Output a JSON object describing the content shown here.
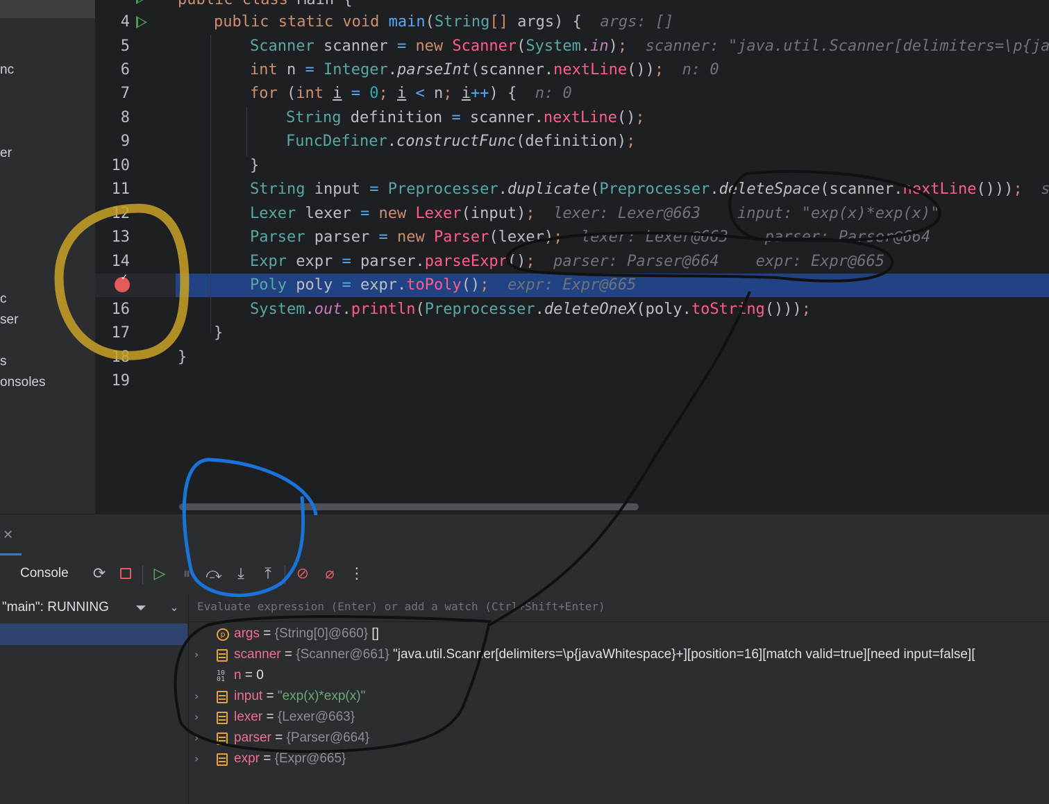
{
  "sidebar": {
    "fragments": [
      "nc",
      "er",
      "c",
      "ser",
      "s",
      "onsoles"
    ]
  },
  "editor": {
    "line_numbers": [
      "4",
      "5",
      "6",
      "7",
      "8",
      "9",
      "10",
      "11",
      "12",
      "13",
      "14",
      "16",
      "17",
      "18",
      "19"
    ],
    "lines": {
      "l3": "public class Main {",
      "l4": "public static void main(String[] args) {",
      "l4_hint": "args: []",
      "l5": "Scanner scanner = new Scanner(System.in);",
      "l5_hint": "scanner: \"java.util.Scanner[delimiters=\\p{jav",
      "l6": "int n = Integer.parseInt(scanner.nextLine());",
      "l6_hint": "n: 0",
      "l7": "for (int i = 0; i < n; i++) {",
      "l7_hint": "n: 0",
      "l8": "String definition = scanner.nextLine();",
      "l9": "FuncDefiner.constructFunc(definition);",
      "l10": "}",
      "l11": "String input = Preprocesser.duplicate(Preprocesser.deleteSpace(scanner.nextLine()));",
      "l11_hint": "sc",
      "l12": "Lexer lexer = new Lexer(input);",
      "l12_hint1": "lexer: Lexer@663",
      "l12_hint2": "input: \"exp(x)*exp(x)\"",
      "l13": "Parser parser = new Parser(lexer);",
      "l13_hint1": "lexer: Lexer@663",
      "l13_hint2": "parser: Parser@664",
      "l14": "Expr expr = parser.parseExpr();",
      "l14_hint1": "parser: Parser@664",
      "l14_hint2": "expr: Expr@665",
      "l15": "Poly poly = expr.toPoly();",
      "l15_hint": "expr: Expr@665",
      "l16": "System.out.println(Preprocesser.deleteOneX(poly.toString()));",
      "l17": "}",
      "l18": "}"
    }
  },
  "debug": {
    "console_tab": "Console",
    "thread": "\"main\": RUNNING",
    "evaluate_placeholder": "Evaluate expression (Enter) or add a watch (Ctrl+Shift+Enter)",
    "variables": [
      {
        "name": "args",
        "eq": " = ",
        "value": "{String[0]@660}",
        "extra": " []",
        "kind": "param",
        "expandable": false
      },
      {
        "name": "scanner",
        "eq": " = ",
        "value": "{Scanner@661}",
        "extra": " \"java.util.Scanner[delimiters=\\p{javaWhitespace}+][position=16][match valid=true][need input=false][",
        "kind": "obj",
        "expandable": true
      },
      {
        "name": "n",
        "eq": " = ",
        "value": "",
        "extra": "0",
        "kind": "prim",
        "expandable": false
      },
      {
        "name": "input",
        "eq": " = ",
        "value": "",
        "extra": "\"exp(x)*exp(x)\"",
        "kind": "obj",
        "expandable": true
      },
      {
        "name": "lexer",
        "eq": " = ",
        "value": "{Lexer@663}",
        "extra": "",
        "kind": "obj",
        "expandable": true
      },
      {
        "name": "parser",
        "eq": " = ",
        "value": "{Parser@664}",
        "extra": "",
        "kind": "obj",
        "expandable": true
      },
      {
        "name": "expr",
        "eq": " = ",
        "value": "{Expr@665}",
        "extra": "",
        "kind": "obj",
        "expandable": true
      }
    ]
  },
  "icons": {
    "rerun": "rerun-icon",
    "stop": "stop-icon",
    "resume": "resume-icon",
    "pause": "pause-icon",
    "step_over": "step-over-icon",
    "step_into": "step-into-icon",
    "step_out": "step-out-icon",
    "view_breakpoints": "view-breakpoints-icon",
    "mute_breakpoints": "mute-breakpoints-icon",
    "more": "more-icon",
    "filter": "filter-icon",
    "dropdown": "chevron-down-icon",
    "close": "close-icon"
  },
  "colors": {
    "keyword": "#cf8e6d",
    "type": "#59a8a3",
    "string": "#6aab73",
    "selection": "#214283",
    "annotation_yellow": "#c9a227",
    "annotation_blue": "#1a73d9",
    "annotation_black": "#111111"
  }
}
